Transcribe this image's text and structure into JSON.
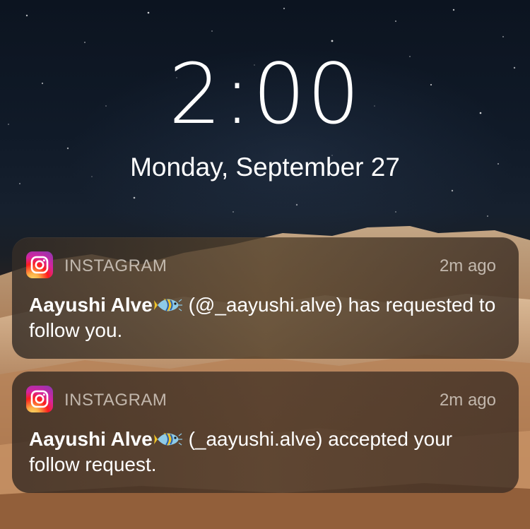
{
  "lockscreen": {
    "time": "2:00",
    "date": "Monday, September 27"
  },
  "notifications": [
    {
      "app": "INSTAGRAM",
      "time_ago": "2m ago",
      "sender": "Aayushi Alve",
      "emoji": "tropical-fish-emoji",
      "text": " (@_aayushi.alve) has requested to follow you."
    },
    {
      "app": "INSTAGRAM",
      "time_ago": "2m ago",
      "sender": "Aayushi Alve",
      "emoji": "tropical-fish-emoji",
      "text": " (_aayushi.alve) accepted your follow request."
    }
  ],
  "icons": {
    "app_icon": "instagram-icon"
  },
  "colors": {
    "instagram_gradient": [
      "#fdd66a",
      "#fcb045",
      "#fd1d1d",
      "#d6249f",
      "#833ab4"
    ],
    "notification_bg": "#3a2e24",
    "text_primary": "#ffffff"
  }
}
